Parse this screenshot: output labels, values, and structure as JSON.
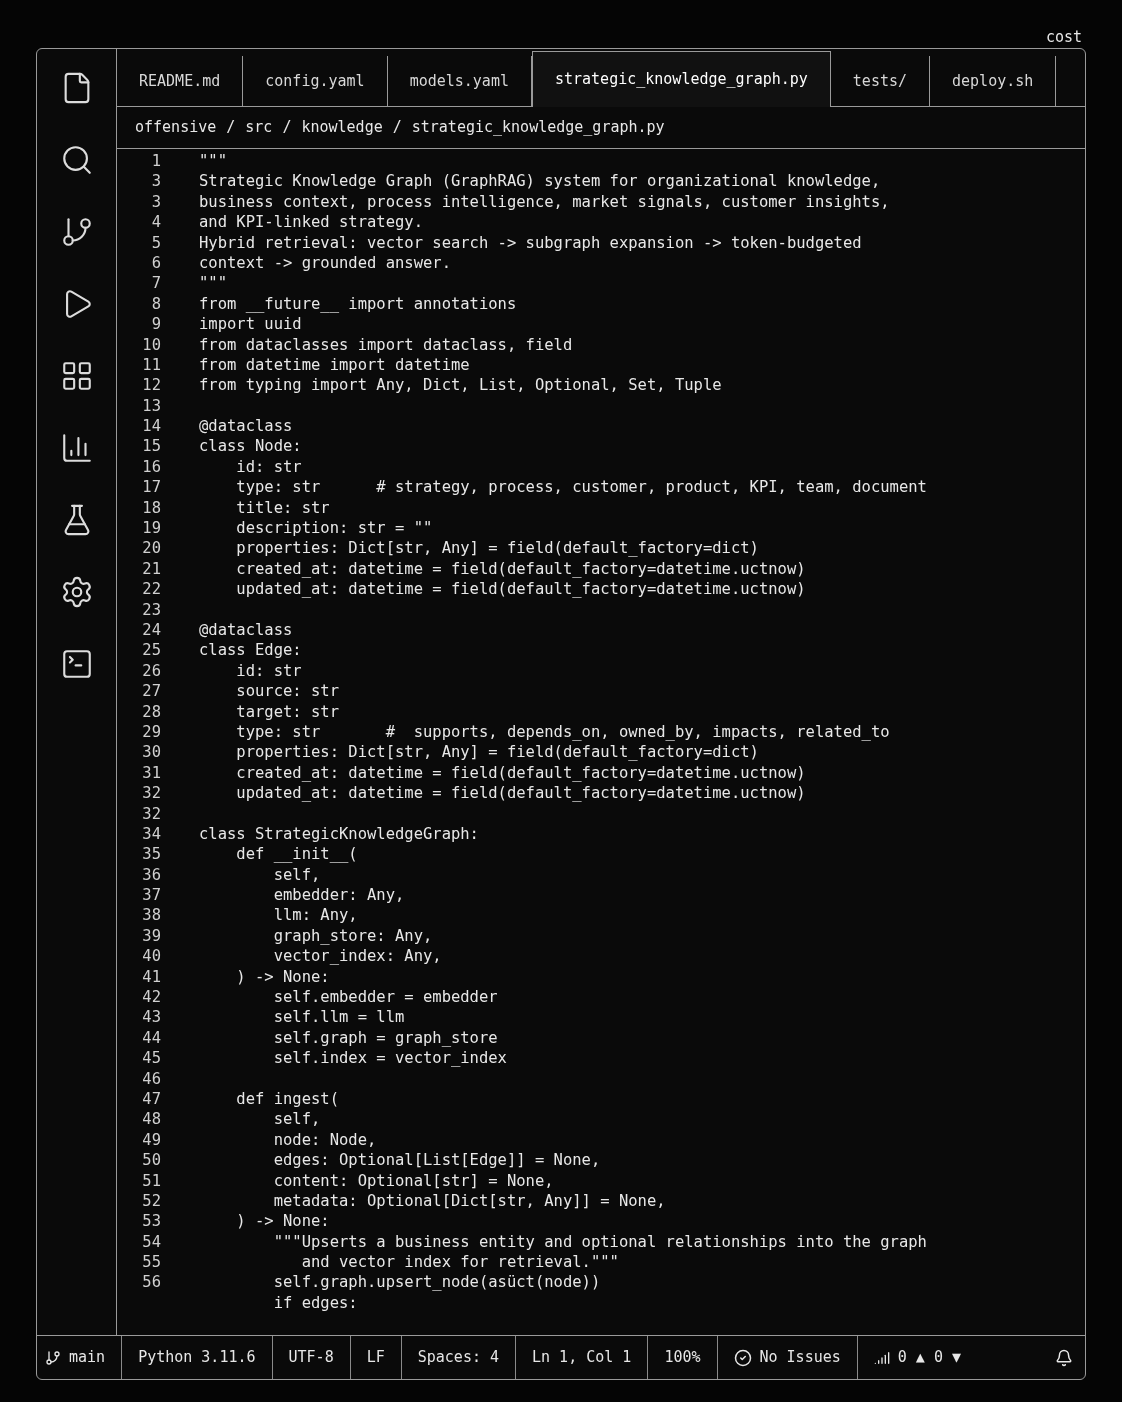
{
  "corner_label": "cost",
  "tabs": [
    {
      "label": "README.md",
      "selected": false
    },
    {
      "label": "config.yaml",
      "selected": false
    },
    {
      "label": "models.yaml",
      "selected": false
    },
    {
      "label": "strategic_knowledge_graph.py",
      "selected": true
    },
    {
      "label": "tests/",
      "selected": false
    },
    {
      "label": "deploy.sh",
      "selected": false
    }
  ],
  "breadcrumb": [
    "offensive",
    "src",
    "knowledge",
    "strategic_knowledge_graph.py"
  ],
  "breadcrumb_separator": "/",
  "lines": [
    {
      "n": "1",
      "code": "\"\"\""
    },
    {
      "n": "3",
      "code": "Strategic Knowledge Graph (GraphRAG) system for organizational knowledge,"
    },
    {
      "n": "3",
      "code": "business context, process intelligence, market signals, customer insights,"
    },
    {
      "n": "4",
      "code": "and KPI-linked strategy."
    },
    {
      "n": "5",
      "code": "Hybrid retrieval: vector search -> subgraph expansion -> token-budgeted"
    },
    {
      "n": "6",
      "code": "context -> grounded answer."
    },
    {
      "n": "7",
      "code": "\"\"\""
    },
    {
      "n": "8",
      "code": "from __future__ import annotations"
    },
    {
      "n": "9",
      "code": "import uuid"
    },
    {
      "n": "10",
      "code": "from dataclasses import dataclass, field"
    },
    {
      "n": "11",
      "code": "from datetime import datetime"
    },
    {
      "n": "12",
      "code": "from typing import Any, Dict, List, Optional, Set, Tuple"
    },
    {
      "n": "13"
    },
    {
      "n": "14",
      "code": "@dataclass"
    },
    {
      "n": "15",
      "code": "class Node:"
    },
    {
      "n": "16",
      "code": "    id: str"
    },
    {
      "n": "17",
      "code": "    type: str      # strategy, process, customer, product, KPI, team, document"
    },
    {
      "n": "18",
      "code": "    title: str"
    },
    {
      "n": "19",
      "code": "    description: str = \"\""
    },
    {
      "n": "20",
      "code": "    properties: Dict[str, Any] = field(default_factory=dict)"
    },
    {
      "n": "21",
      "code": "    created_at: datetime = field(default_factory=datetime.uctnow)"
    },
    {
      "n": "22",
      "code": "    updated_at: datetime = field(default_factory=datetime.uctnow)"
    },
    {
      "n": "23"
    },
    {
      "n": "24",
      "code": "@dataclass"
    },
    {
      "n": "25",
      "code": "class Edge:"
    },
    {
      "n": "26",
      "code": "    id: str"
    },
    {
      "n": "27",
      "code": "    source: str"
    },
    {
      "n": "28",
      "code": "    target: str"
    },
    {
      "n": "29",
      "code": "    type: str       #  supports, depends_on, owned_by, impacts, related_to"
    },
    {
      "n": "30",
      "code": "    properties: Dict[str, Any] = field(default_factory=dict)"
    },
    {
      "n": "31",
      "code": "    created_at: datetime = field(default_factory=datetime.uctnow)"
    },
    {
      "n": "32",
      "code": "    updated_at: datetime = field(default_factory=datetime.uctnow)"
    },
    {
      "n": "32"
    },
    {
      "n": "34",
      "code": "class StrategicKnowledgeGraph:"
    },
    {
      "n": "35",
      "code": "    def __init__("
    },
    {
      "n": "36",
      "code": "        self,"
    },
    {
      "n": "37",
      "code": "        embedder: Any,"
    },
    {
      "n": "38",
      "code": "        llm: Any,"
    },
    {
      "n": "39",
      "code": "        graph_store: Any,"
    },
    {
      "n": "40",
      "code": "        vector_index: Any,"
    },
    {
      "n": "41",
      "code": "    ) -> None:"
    },
    {
      "n": "42",
      "code": "        self.embedder = embedder"
    },
    {
      "n": "43",
      "code": "        self.llm = llm"
    },
    {
      "n": "44",
      "code": "        self.graph = graph_store"
    },
    {
      "n": "45",
      "code": "        self.index = vector_index"
    },
    {
      "n": "46"
    },
    {
      "n": "47",
      "code": "    def ingest("
    },
    {
      "n": "48",
      "code": "        self,"
    },
    {
      "n": "49",
      "code": "        node: Node,"
    },
    {
      "n": "50",
      "code": "        edges: Optional[List[Edge]] = None,"
    },
    {
      "n": "51",
      "code": "        content: Optional[str] = None,"
    },
    {
      "n": "52",
      "code": "        metadata: Optional[Dict[str, Any]] = None,"
    },
    {
      "n": "53",
      "code": "    ) -> None:"
    },
    {
      "n": "54",
      "code": "        \"\"\"Upserts a business entity and optional relationships into the graph"
    },
    {
      "n": "55",
      "code": "           and vector index for retrieval.\"\"\""
    },
    {
      "n": "56",
      "code": "        self.graph.upsert_node(asüct(node))"
    },
    {
      "code": "        if edges:"
    }
  ],
  "status_bar": [
    {
      "kind": "branch",
      "text": "main"
    },
    {
      "kind": "text",
      "text": "Python 3.11.6"
    },
    {
      "kind": "text",
      "text": "UTF-8"
    },
    {
      "kind": "text",
      "text": "LF"
    },
    {
      "kind": "text",
      "text": "Spaces: 4"
    },
    {
      "kind": "text",
      "text": "Ln 1, Col 1"
    },
    {
      "kind": "text",
      "text": "100%"
    },
    {
      "kind": "issues",
      "text": "No Issues"
    },
    {
      "kind": "sync",
      "text": "0 ▲ 0 ▼"
    },
    {
      "kind": "bell"
    }
  ]
}
